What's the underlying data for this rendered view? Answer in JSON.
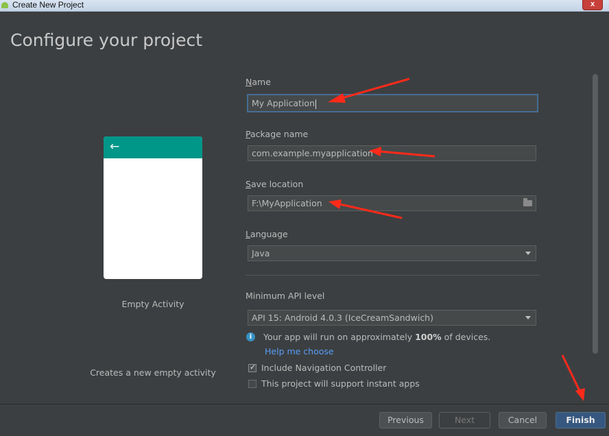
{
  "window": {
    "title": "Create New Project",
    "close_label": "x"
  },
  "page": {
    "title": "Configure your project"
  },
  "template": {
    "name": "Empty Activity",
    "description": "Creates a new empty activity"
  },
  "fields": {
    "name": {
      "label_mnemonic": "N",
      "label_rest": "ame",
      "value": "My Application"
    },
    "package": {
      "label_mnemonic": "P",
      "label_rest": "ackage name",
      "value": "com.example.myapplication"
    },
    "save_location": {
      "label_mnemonic": "S",
      "label_rest": "ave location",
      "value": "F:\\MyApplication"
    },
    "language": {
      "label_mnemonic": "L",
      "label_rest": "anguage",
      "value": "Java"
    },
    "min_api": {
      "label": "Minimum API level",
      "value": "API 15: Android 4.0.3 (IceCreamSandwich)"
    }
  },
  "info": {
    "text_before": "Your app will run on approximately ",
    "percent": "100%",
    "text_after": " of devices.",
    "help_link": "Help me choose"
  },
  "checkboxes": [
    {
      "label": "Include Navigation Controller",
      "checked": true
    },
    {
      "label": "This project will support instant apps",
      "checked": false
    }
  ],
  "buttons": {
    "previous": "Previous",
    "next": "Next",
    "cancel": "Cancel",
    "finish": "Finish"
  },
  "colors": {
    "background": "#3c3f41",
    "accent_teal": "#009688",
    "primary_button": "#365880",
    "link": "#589df6",
    "annotation_arrow": "#ff2a1a"
  }
}
